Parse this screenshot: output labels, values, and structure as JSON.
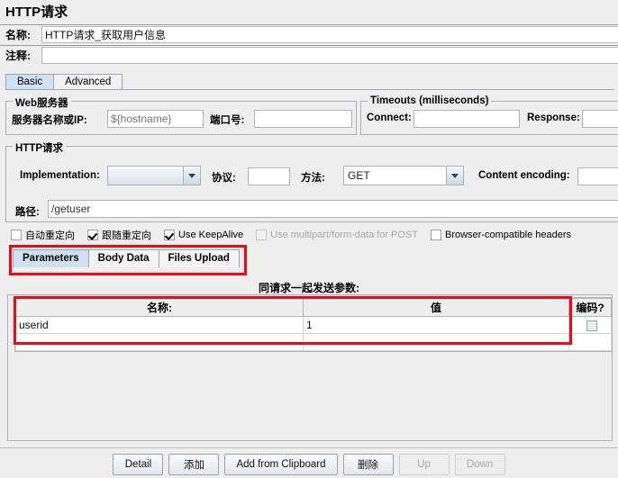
{
  "window": {
    "title": "HTTP请求"
  },
  "header": {
    "name_label": "名称:",
    "name_value": "HTTP请求_获取用户信息",
    "comment_label": "注释:",
    "comment_value": ""
  },
  "tabs": [
    {
      "label": "Basic",
      "selected": true
    },
    {
      "label": "Advanced",
      "selected": false
    }
  ],
  "web_server": {
    "group_title": "Web服务器",
    "server_label": "服务器名称或IP:",
    "server_value": "${hostname}",
    "port_label": "端口号:",
    "port_value": ""
  },
  "timeouts": {
    "group_title": "Timeouts (milliseconds)",
    "connect_label": "Connect:",
    "connect_value": "",
    "response_label": "Response:",
    "response_value": ""
  },
  "http_request": {
    "group_title": "HTTP请求",
    "implementation_label": "Implementation:",
    "implementation_value": "",
    "protocol_label": "协议:",
    "protocol_value": "",
    "method_label": "方法:",
    "method_value": "GET",
    "content_encoding_label": "Content encoding:",
    "content_encoding_value": "",
    "path_label": "路径:",
    "path_value": "/getuser"
  },
  "checkboxes": [
    {
      "label": "自动重定向",
      "checked": false,
      "disabled": false
    },
    {
      "label": "跟随重定向",
      "checked": true,
      "disabled": false
    },
    {
      "label": "Use KeepAlive",
      "checked": true,
      "disabled": false
    },
    {
      "label": "Use multipart/form-data for POST",
      "checked": false,
      "disabled": true
    },
    {
      "label": "Browser-compatible headers",
      "checked": false,
      "disabled": false
    }
  ],
  "sub_tabs": [
    {
      "label": "Parameters",
      "selected": true
    },
    {
      "label": "Body Data",
      "selected": false
    },
    {
      "label": "Files Upload",
      "selected": false
    }
  ],
  "parameters": {
    "caption": "同请求一起发送参数:",
    "columns": [
      "名称:",
      "值",
      "编码?"
    ],
    "rows": [
      {
        "name": "userid",
        "value": "1",
        "encode": false
      }
    ]
  },
  "buttons": [
    {
      "label": "Detail",
      "disabled": false
    },
    {
      "label": "添加",
      "disabled": false
    },
    {
      "label": "Add from Clipboard",
      "disabled": false
    },
    {
      "label": "删除",
      "disabled": false
    },
    {
      "label": "Up",
      "disabled": true
    },
    {
      "label": "Down",
      "disabled": true
    }
  ],
  "annotations": {
    "accent_color": "#f60614"
  }
}
